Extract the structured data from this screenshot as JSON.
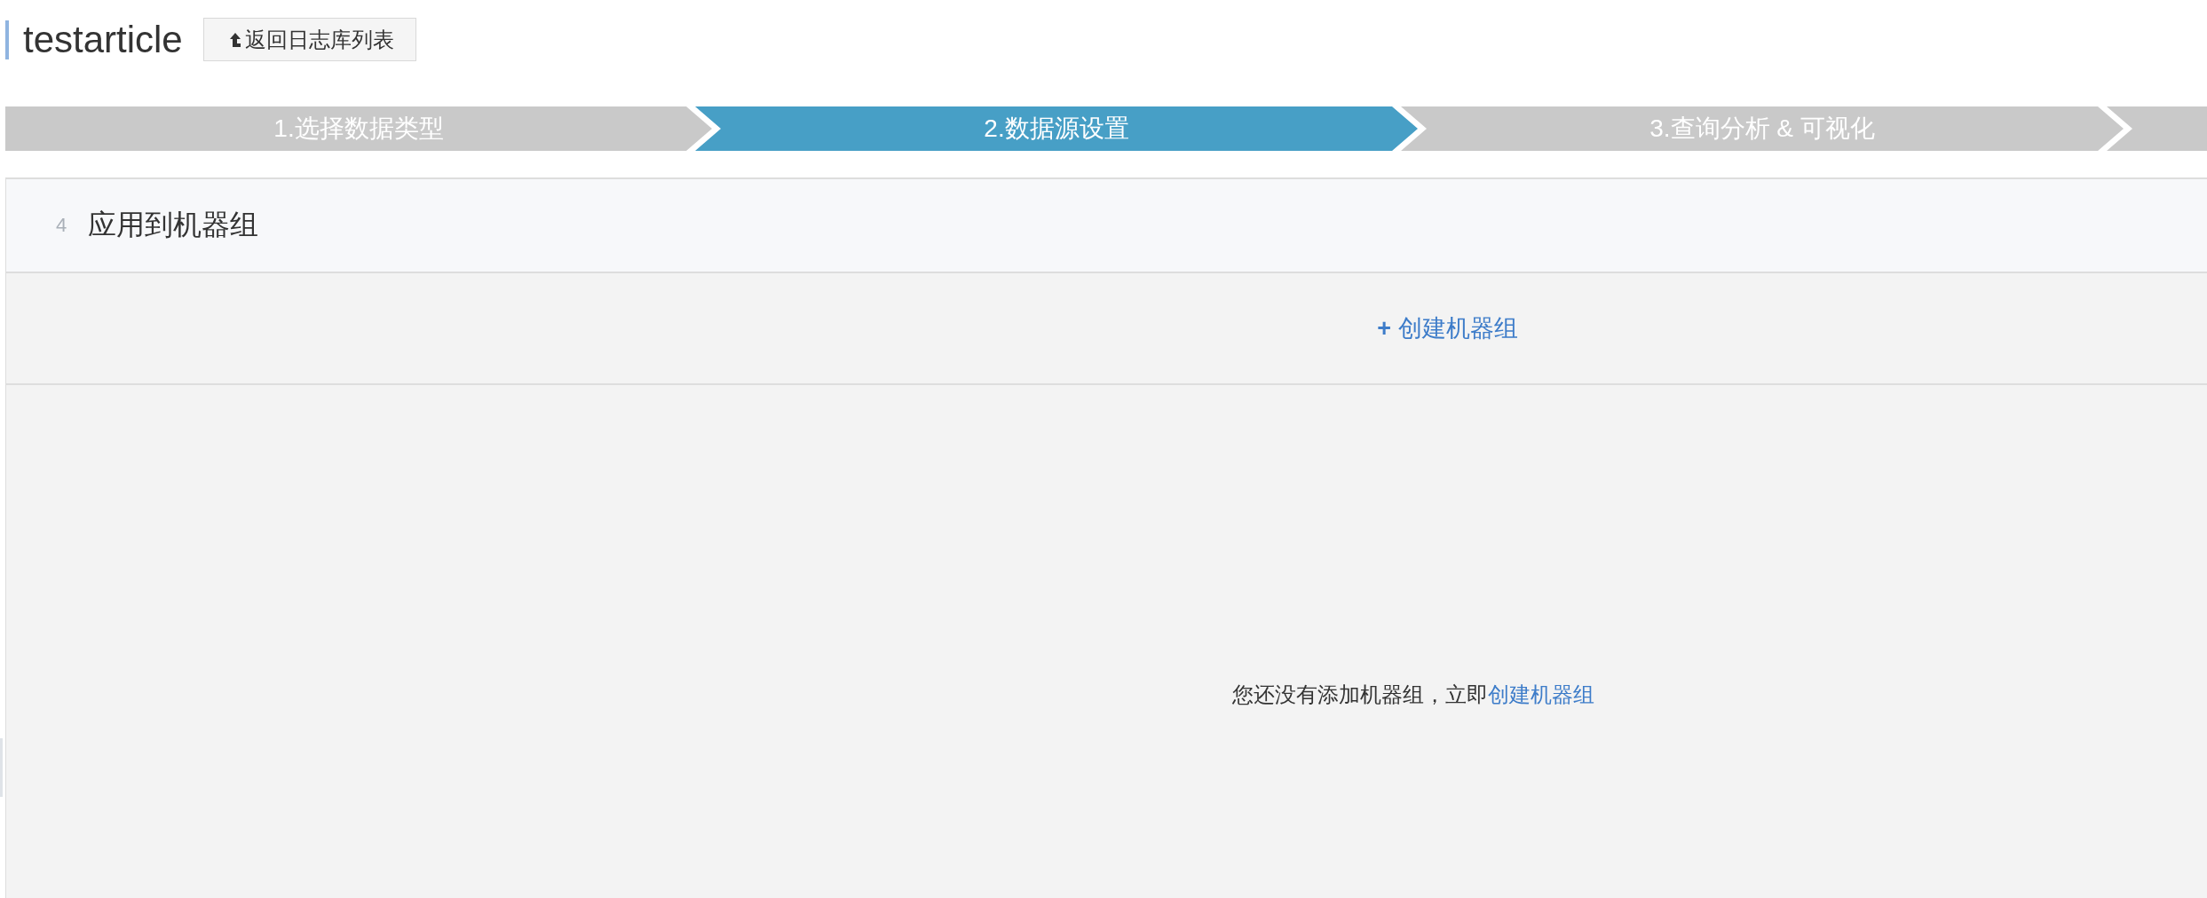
{
  "header": {
    "title": "testarticle",
    "back_button": "返回日志库列表"
  },
  "steps": [
    {
      "label": "1.选择数据类型",
      "selected": false
    },
    {
      "label": "2.数据源设置",
      "selected": true
    },
    {
      "label": "3.查询分析 & 可视化",
      "selected": false
    },
    {
      "selected": false
    }
  ],
  "panel": {
    "step_number": "4",
    "title": "应用到机器组",
    "create_link": "**+** 创建机器组",
    "empty_state": {
      "text": "您还没有添加机器组，立即",
      "link": "创建机器组"
    }
  }
}
